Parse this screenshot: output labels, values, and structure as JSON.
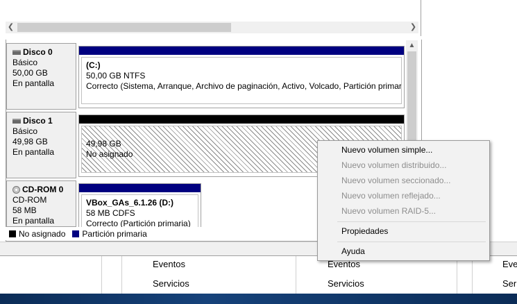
{
  "colors": {
    "primary_partition": "#000080",
    "unallocated": "#000000",
    "menu_disabled": "#8d8d8d"
  },
  "disks": [
    {
      "name": "Disco 0",
      "type": "Básico",
      "size": "50,00 GB",
      "status": "En pantalla",
      "partition": {
        "label": "(C:)",
        "size_fs": "50,00 GB NTFS",
        "status": "Correcto (Sistema, Arranque, Archivo de paginación, Activo, Volcado, Partición primar"
      }
    },
    {
      "name": "Disco 1",
      "type": "Básico",
      "size": "49,98 GB",
      "status": "En pantalla",
      "partition": {
        "size": "49,98 GB",
        "state": "No asignado"
      }
    },
    {
      "name": "CD-ROM 0",
      "type": "CD-ROM",
      "size": "58 MB",
      "status": "En pantalla",
      "partition": {
        "label": "VBox_GAs_6.1.26  (D:)",
        "size_fs": "58 MB CDFS",
        "status": "Correcto (Partición primaria)"
      }
    }
  ],
  "legend": {
    "unallocated": "No asignado",
    "primary": "Partición primaria"
  },
  "context_menu": {
    "items": [
      {
        "label": "Nuevo volumen simple...",
        "enabled": true
      },
      {
        "label": "Nuevo volumen distribuido...",
        "enabled": false
      },
      {
        "label": "Nuevo volumen seccionado...",
        "enabled": false
      },
      {
        "label": "Nuevo volumen reflejado...",
        "enabled": false
      },
      {
        "label": "Nuevo volumen RAID-5...",
        "enabled": false
      },
      {
        "label": "Propiedades",
        "enabled": true
      },
      {
        "label": "Ayuda",
        "enabled": true
      }
    ]
  },
  "bottom_panes": {
    "col1": [
      "Eventos",
      "Servicios"
    ],
    "col2": [
      "Eventos",
      "Servicios"
    ],
    "col3": [
      "Eve",
      "Ser"
    ]
  },
  "icons": {
    "scroll_left": "chevron-left-icon",
    "scroll_right": "chevron-right-icon",
    "scroll_up": "chevron-up-icon",
    "disk": "disk-drive-icon",
    "cdrom": "cdrom-icon"
  }
}
